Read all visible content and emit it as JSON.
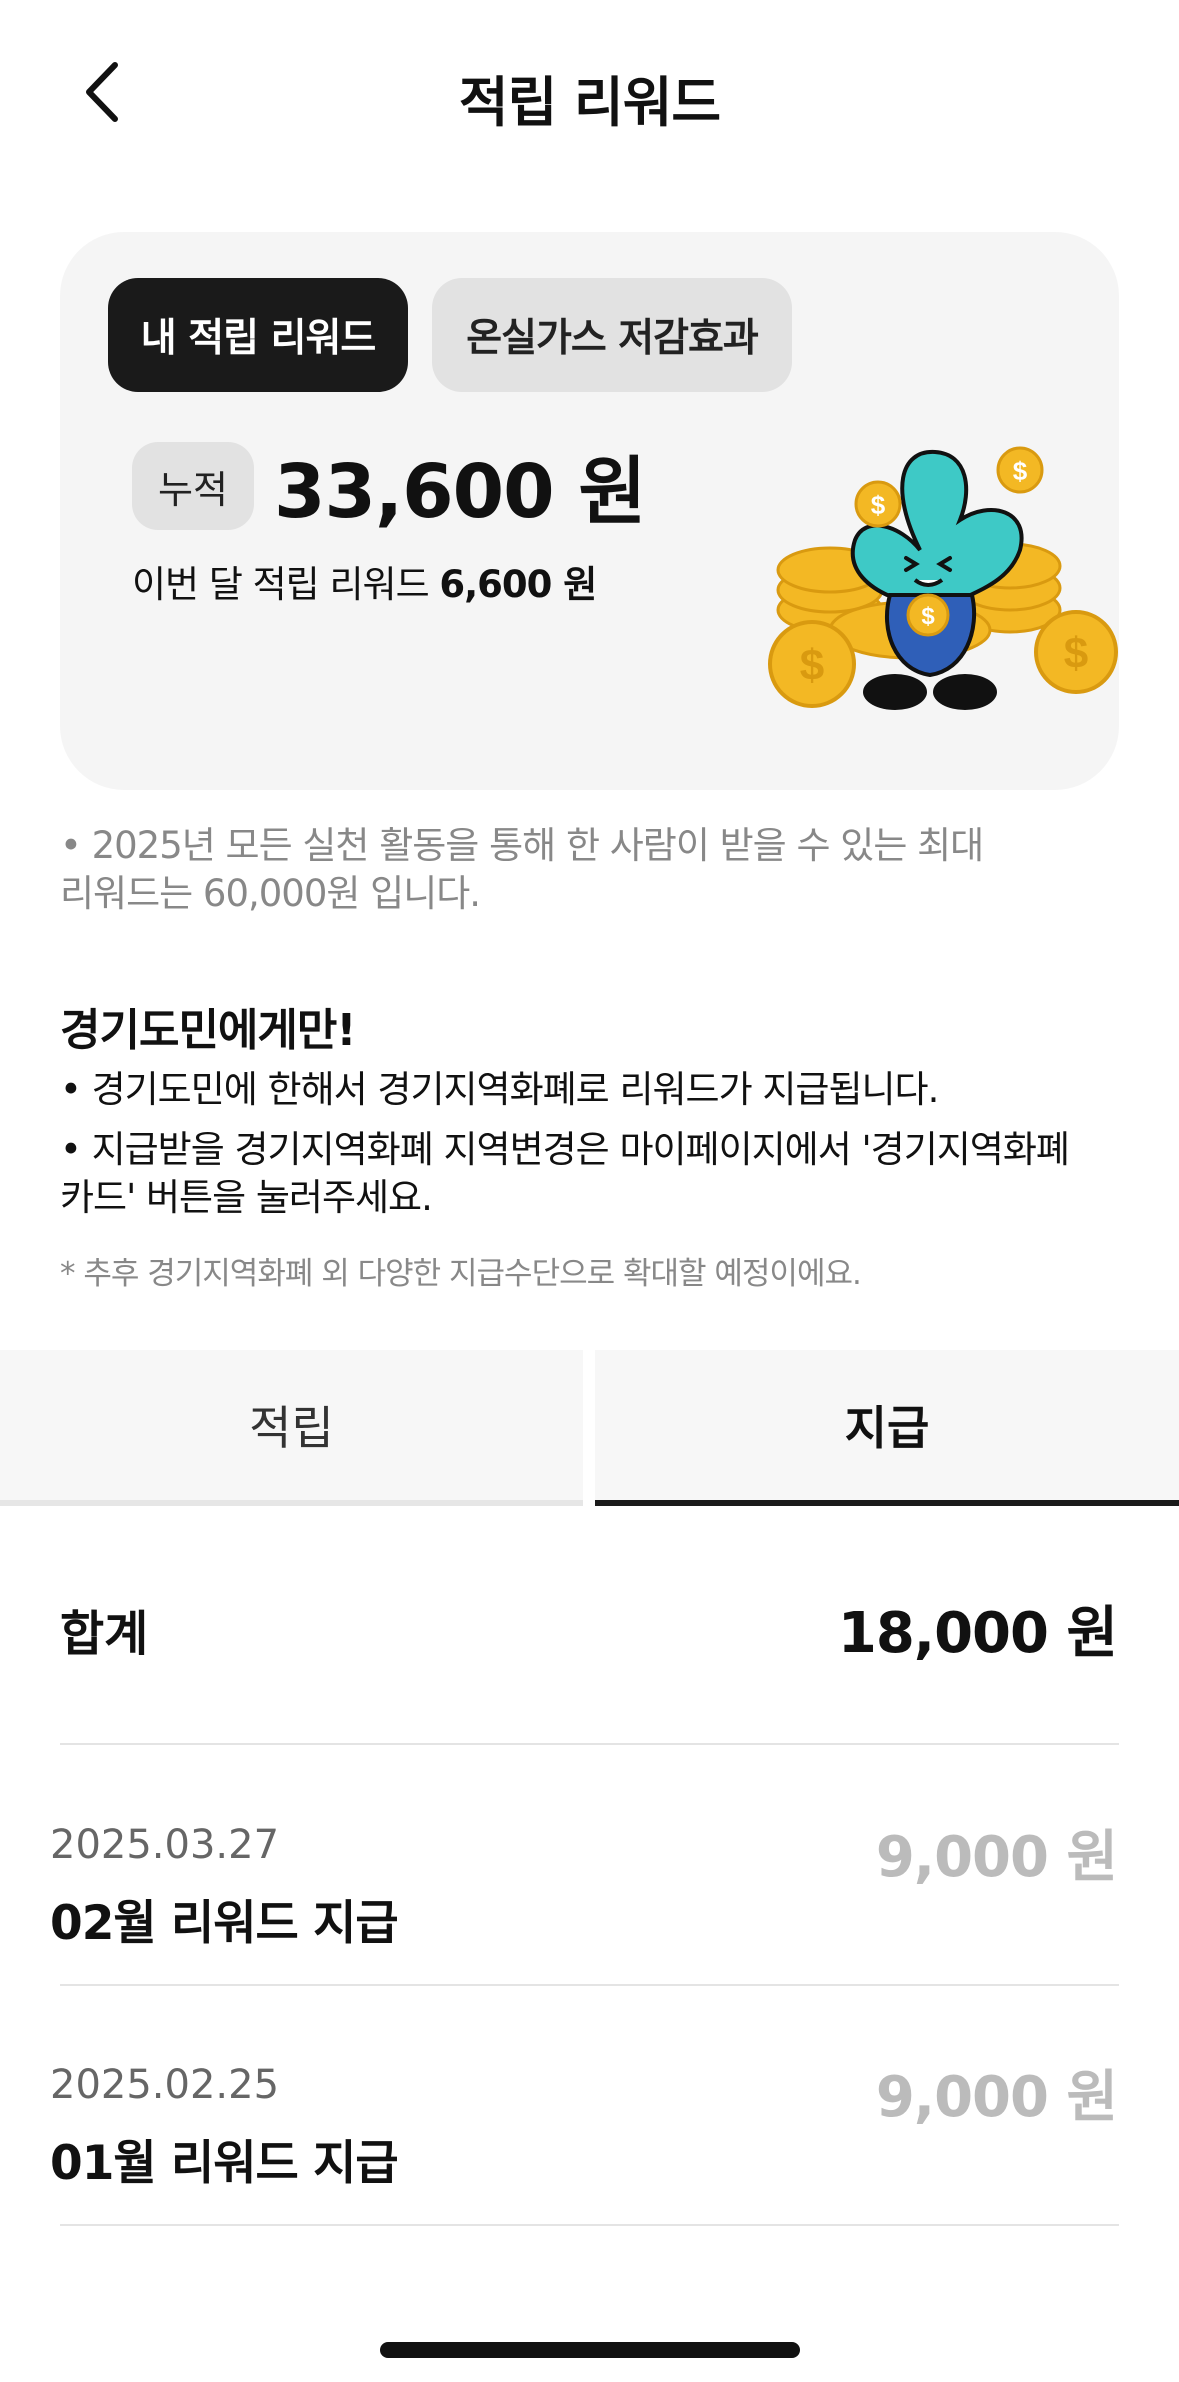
{
  "header": {
    "title": "적립 리워드"
  },
  "card": {
    "tab_active": "내 적립 리워드",
    "tab_inactive": "온실가스 저감효과",
    "badge": "누적",
    "total": "33,600 원",
    "monthly_label": "이번 달 적립 리워드",
    "monthly_value": "6,600 원"
  },
  "notice": {
    "line1": "• 2025년 모든 실천 활동을 통해 한 사람이 받을 수 있는 최대",
    "line2": "리워드는 60,000원 입니다."
  },
  "info": {
    "title": "경기도민에게만!",
    "line1": "• 경기도민에 한해서 경기지역화폐로 리워드가 지급됩니다.",
    "line2": "• 지급받을 경기지역화폐 지역변경은 마이페이지에서 '경기지역화폐",
    "line3": "카드' 버튼을 눌러주세요.",
    "note": "* 추후 경기지역화폐 외 다양한 지급수단으로 확대할 예정이에요."
  },
  "tabs": {
    "left": "적립",
    "right": "지급"
  },
  "summary": {
    "label": "합계",
    "value": "18,000 원"
  },
  "rows": [
    {
      "date": "2025.03.27",
      "title": "02월 리워드 지급",
      "amount": "9,000 원"
    },
    {
      "date": "2025.02.25",
      "title": "01월 리워드 지급",
      "amount": "9,000 원"
    }
  ],
  "colors": {
    "accent_dark": "#1a1a1a",
    "card_bg": "#f5f5f5",
    "muted": "#888888",
    "amount_muted": "#bbbbbb",
    "mascot": "#3ec9c6",
    "coin": "#f3b824"
  }
}
